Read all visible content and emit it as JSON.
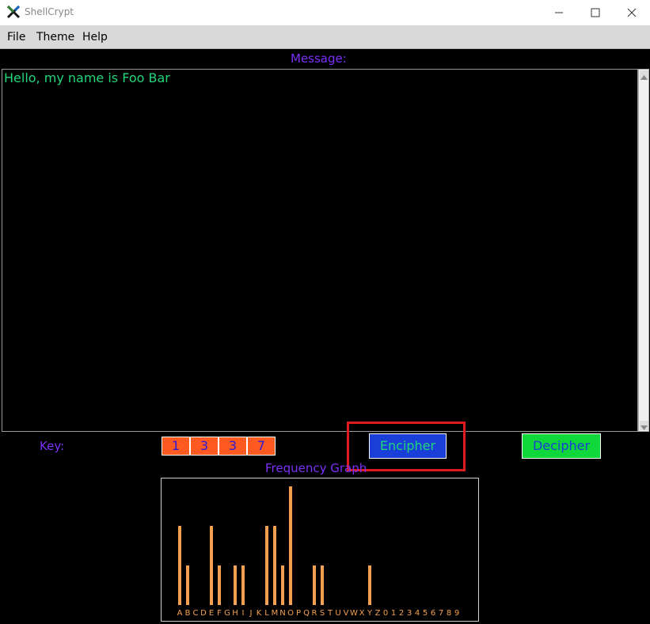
{
  "window": {
    "title": "ShellCrypt"
  },
  "menu": {
    "items": [
      "File",
      "Theme",
      "Help"
    ]
  },
  "message": {
    "label": "Message:",
    "text": "Hello, my name is Foo Bar"
  },
  "key": {
    "label": "Key:",
    "digits": [
      "1",
      "3",
      "3",
      "7"
    ]
  },
  "buttons": {
    "encipher": "Encipher",
    "decipher": "Decipher"
  },
  "graph": {
    "title": "Frequency Graph"
  },
  "colors": {
    "accent": "#7b2ff7",
    "message_text": "#22d67a",
    "key_cell": "#ff5a22",
    "encipher_bg": "#1a3ed8",
    "decipher_bg": "#10d83a",
    "bars": "#f5a050",
    "highlight": "#e01b1b"
  },
  "chart_data": {
    "type": "bar",
    "title": "Frequency Graph",
    "categories": [
      "A",
      "B",
      "C",
      "D",
      "E",
      "F",
      "G",
      "H",
      "I",
      "J",
      "K",
      "L",
      "M",
      "N",
      "O",
      "P",
      "Q",
      "R",
      "S",
      "T",
      "U",
      "V",
      "W",
      "X",
      "Y",
      "Z",
      "0",
      "1",
      "2",
      "3",
      "4",
      "5",
      "6",
      "7",
      "8",
      "9"
    ],
    "values": [
      2,
      1,
      0,
      0,
      2,
      1,
      0,
      1,
      1,
      0,
      0,
      2,
      2,
      1,
      3,
      0,
      0,
      1,
      1,
      0,
      0,
      0,
      0,
      0,
      1,
      0,
      0,
      0,
      0,
      0,
      0,
      0,
      0,
      0,
      0,
      0
    ],
    "ylim": [
      0,
      3
    ]
  }
}
